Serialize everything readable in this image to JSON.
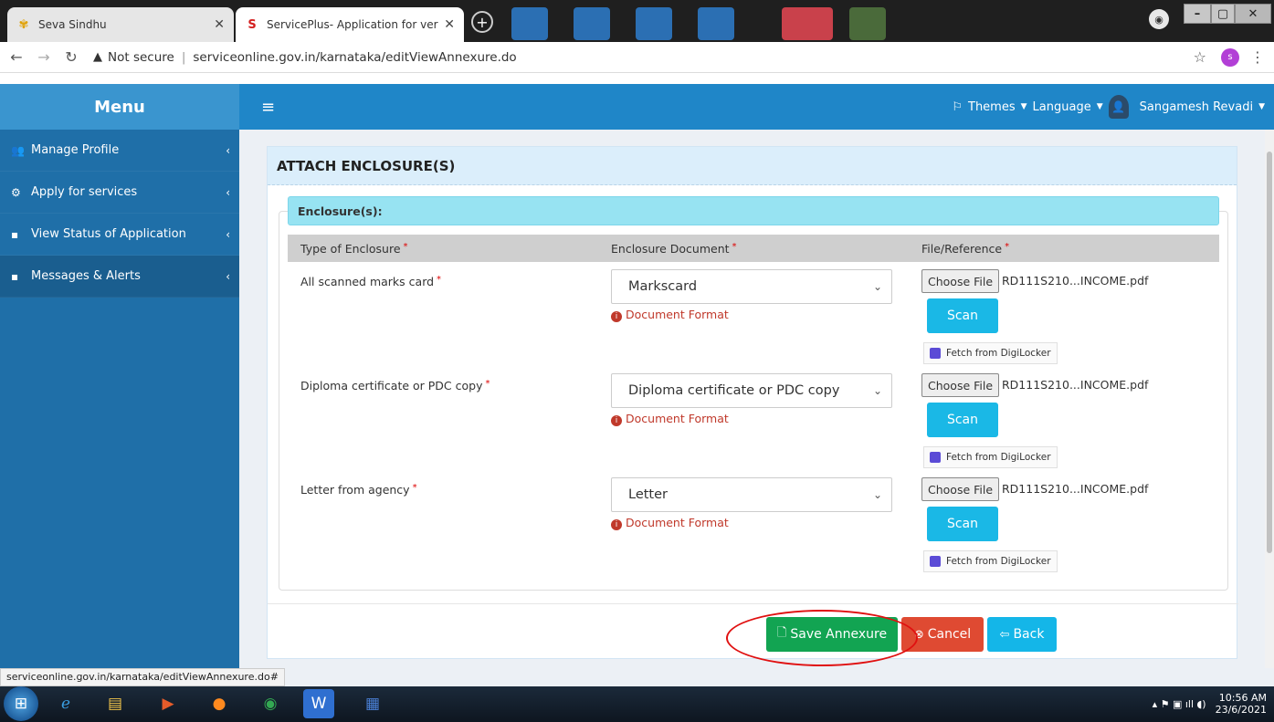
{
  "browser": {
    "tabs": [
      {
        "title": "Seva Sindhu",
        "active": false
      },
      {
        "title": "ServicePlus- Application for verif",
        "active": true
      }
    ],
    "security_label": "Not secure",
    "url": "serviceonline.gov.in/karnataka/editViewAnnexure.do",
    "profile_initial": "s",
    "status_url": "serviceonline.gov.in/karnataka/editViewAnnexure.do#"
  },
  "sidebar": {
    "title": "Menu",
    "items": [
      {
        "label": "Manage Profile",
        "icon": "users-icon"
      },
      {
        "label": "Apply for services",
        "icon": "cogs-icon"
      },
      {
        "label": "View Status of Application",
        "icon": "list-icon"
      },
      {
        "label": "Messages & Alerts",
        "icon": "list-icon"
      }
    ]
  },
  "header": {
    "themes": "Themes",
    "language": "Language",
    "user_name": "Sangamesh Revadi"
  },
  "panel": {
    "title": "ATTACH ENCLOSURE(S)",
    "enclosures_title": "Enclosure(s):",
    "columns": [
      "Type of Enclosure",
      "Enclosure Document",
      "File/Reference"
    ],
    "rows": [
      {
        "type": "All scanned marks card",
        "document": "Markscard",
        "format": "Document Format",
        "choose": "Choose File",
        "file": "RD111S210...INCOME.pdf",
        "scan": "Scan",
        "digilocker": "Fetch from DigiLocker"
      },
      {
        "type": "Diploma certificate or PDC copy",
        "document": "Diploma certificate or PDC copy",
        "format": "Document Format",
        "choose": "Choose File",
        "file": "RD111S210...INCOME.pdf",
        "scan": "Scan",
        "digilocker": "Fetch from DigiLocker"
      },
      {
        "type": "Letter from agency",
        "document": "Letter",
        "format": "Document Format",
        "choose": "Choose File",
        "file": "RD111S210...INCOME.pdf",
        "scan": "Scan",
        "digilocker": "Fetch from DigiLocker"
      }
    ],
    "buttons": {
      "save": "Save Annexure",
      "cancel": "Cancel",
      "back": "Back"
    }
  },
  "taskbar": {
    "time": "10:56 AM",
    "date": "23/6/2021"
  }
}
